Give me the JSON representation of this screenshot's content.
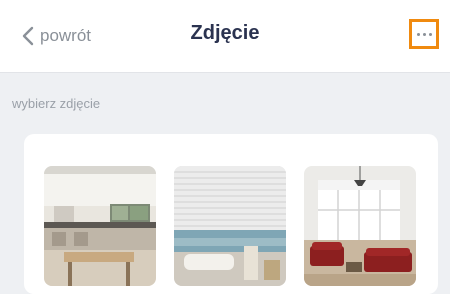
{
  "header": {
    "back_label": "powrót",
    "title": "Zdjęcie",
    "more_icon": "more-dots-icon"
  },
  "section": {
    "label": "wybierz zdjęcie"
  },
  "photos": [
    {
      "name": "kitchen-interior-photo"
    },
    {
      "name": "bathroom-blinds-photo"
    },
    {
      "name": "living-room-red-sofa-photo"
    }
  ],
  "colors": {
    "highlight": "#f08a0f",
    "title": "#2b3350",
    "muted": "#8a9098"
  }
}
